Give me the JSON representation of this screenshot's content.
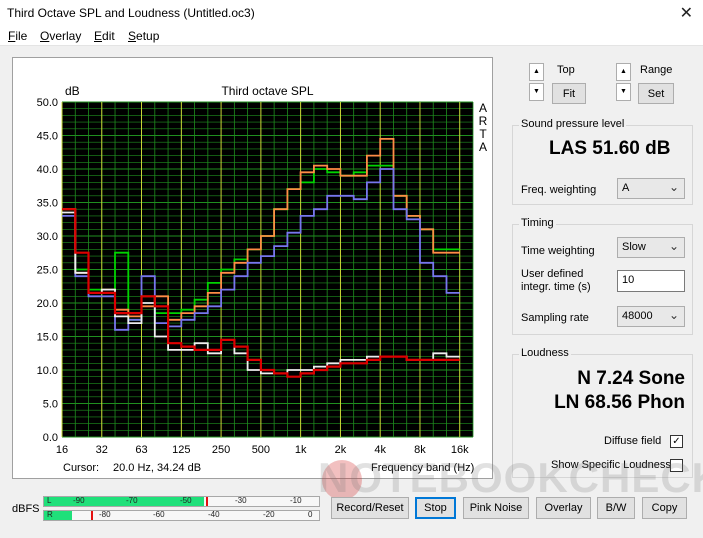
{
  "window": {
    "title": "Third Octave SPL and Loudness (Untitled.oc3)"
  },
  "menu": [
    "File",
    "Overlay",
    "Edit",
    "Setup"
  ],
  "chart": {
    "title": "Third octave SPL",
    "ylabel": "dB",
    "xlabel": "Frequency band (Hz)",
    "side_label": [
      "A",
      "R",
      "T",
      "A"
    ],
    "cursor_label": "Cursor:",
    "cursor_value": "20.0 Hz, 34.24 dB",
    "colors": {
      "green": "#00d400",
      "orange": "#ff8c46",
      "blue": "#7777ee",
      "white": "#eeeeee",
      "red": "#dd0000",
      "grid": "#1f8f1f",
      "grid_major": "#dde03a",
      "background": "#000000"
    }
  },
  "chart_data": {
    "type": "line",
    "title": "Third octave SPL",
    "ylabel": "dB",
    "xlabel": "Frequency band (Hz)",
    "ylim": [
      0,
      50
    ],
    "yticks": [
      "50.0",
      "45.0",
      "40.0",
      "35.0",
      "30.0",
      "25.0",
      "20.0",
      "15.0",
      "10.0",
      "5.0",
      "0.0"
    ],
    "xtick_labels": [
      "16",
      "32",
      "63",
      "125",
      "250",
      "500",
      "1k",
      "2k",
      "4k",
      "8k",
      "16k"
    ],
    "bands": [
      "20",
      "25",
      "31.5",
      "40",
      "50",
      "63",
      "80",
      "100",
      "125",
      "160",
      "200",
      "250",
      "315",
      "400",
      "500",
      "630",
      "800",
      "1k",
      "1.25k",
      "1.6k",
      "2k",
      "2.5k",
      "3.15k",
      "4k",
      "5k",
      "6.3k",
      "8k",
      "10k",
      "12.5k",
      "16k",
      "20k"
    ],
    "series": [
      {
        "color": "green",
        "values": [
          34,
          25,
          22,
          22,
          27.5,
          17.5,
          21,
          18.5,
          18.5,
          19,
          20.5,
          23,
          25,
          26.5,
          28,
          30,
          34,
          37,
          38,
          40,
          39.5,
          39,
          39.5,
          40.5,
          40.5,
          36,
          33,
          31,
          28,
          28
        ]
      },
      {
        "color": "orange",
        "values": [
          34,
          24.5,
          21.5,
          22,
          19,
          18,
          19.5,
          21,
          17.5,
          18.5,
          19.5,
          21.5,
          24.5,
          26,
          28,
          30,
          34,
          37,
          39.5,
          40.5,
          40,
          39,
          39,
          42,
          44.5,
          36,
          33,
          31,
          27.5,
          27.5
        ]
      },
      {
        "color": "blue",
        "values": [
          33,
          24,
          21,
          21,
          16,
          17.5,
          24,
          17,
          16.5,
          17.5,
          18.5,
          19.5,
          22,
          24,
          26,
          27,
          28.5,
          30.5,
          33,
          34,
          36,
          36,
          35.5,
          38,
          40,
          34,
          32.5,
          26,
          24,
          21.5
        ]
      },
      {
        "color": "white",
        "values": [
          33.5,
          24.5,
          21.5,
          22,
          18,
          17,
          20,
          15,
          13,
          13,
          14,
          12.5,
          14.5,
          12.5,
          10,
          9.5,
          9.5,
          10,
          10,
          10.5,
          11,
          11.5,
          11.5,
          12,
          12,
          12,
          11.5,
          11.5,
          12.5,
          12
        ]
      },
      {
        "color": "red",
        "values": [
          34,
          27.5,
          21.5,
          21.5,
          18.5,
          18.5,
          21,
          19.5,
          14,
          13.5,
          13,
          13,
          14.5,
          13.5,
          11.5,
          10,
          9.5,
          9,
          9.5,
          10,
          10.5,
          11,
          11,
          11.5,
          12,
          12,
          11.5,
          11.5,
          11.5,
          11.5
        ]
      }
    ]
  },
  "top": {
    "label": "Top",
    "fit": "Fit"
  },
  "range": {
    "label": "Range",
    "set": "Set"
  },
  "spl": {
    "title": "Sound pressure level",
    "value": "LAS 51.60 dB",
    "freq_weighting_label": "Freq. weighting",
    "freq_weighting_value": "A"
  },
  "timing": {
    "title": "Timing",
    "time_weighting_label": "Time weighting",
    "time_weighting_value": "Slow",
    "integr_label_1": "User defined",
    "integr_label_2": "integr. time (s)",
    "integr_value": "10",
    "sampling_label": "Sampling rate",
    "sampling_value": "48000"
  },
  "loudness": {
    "title": "Loudness",
    "sone": "N 7.24 Sone",
    "phon": "LN 68.56 Phon",
    "diffuse_label": "Diffuse field",
    "diffuse_checked": true,
    "specific_label": "Show Specific Loudness",
    "specific_checked": false
  },
  "meter": {
    "label": "dBFS",
    "left_ch": "L",
    "right_ch": "R",
    "left_marks": [
      "-90",
      "-70",
      "-50",
      "-30",
      "-10"
    ],
    "right_marks": [
      "-80",
      "-60",
      "-40",
      "-20",
      "0"
    ],
    "left_level": 0.58,
    "left_peak": 0.59,
    "right_level": 0.1,
    "right_peak": 0.17
  },
  "buttons": {
    "record": "Record/Reset",
    "stop": "Stop",
    "pink": "Pink Noise",
    "overlay": "Overlay",
    "bw": "B/W",
    "copy": "Copy"
  },
  "watermark": "NOTEBOOKCHECK"
}
